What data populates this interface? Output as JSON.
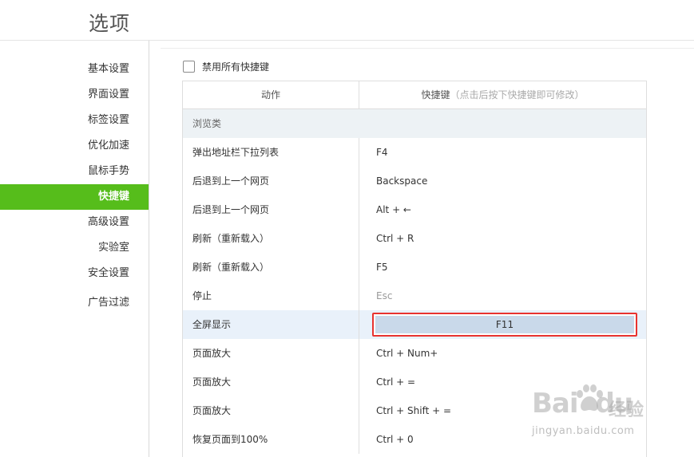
{
  "page": {
    "title": "选项"
  },
  "sidebar": {
    "items": [
      {
        "label": "基本设置",
        "active": false
      },
      {
        "label": "界面设置",
        "active": false
      },
      {
        "label": "标签设置",
        "active": false
      },
      {
        "label": "优化加速",
        "active": false
      },
      {
        "label": "鼠标手势",
        "active": false
      },
      {
        "label": "快捷键",
        "active": true
      },
      {
        "label": "高级设置",
        "active": false
      },
      {
        "label": "实验室",
        "active": false
      },
      {
        "label": "安全设置",
        "active": false
      },
      {
        "label": "广告过滤",
        "active": false
      }
    ]
  },
  "options": {
    "disable_all_label": "禁用所有快捷键",
    "disable_all_checked": false
  },
  "table": {
    "header": {
      "action": "动作",
      "shortcut": "快捷键",
      "shortcut_hint": "（点击后按下快捷键即可修改）"
    },
    "category": "浏览类",
    "rows": [
      {
        "action": "弹出地址栏下拉列表",
        "key": "F4"
      },
      {
        "action": "后退到上一个网页",
        "key": "Backspace"
      },
      {
        "action": "后退到上一个网页",
        "key": "Alt + ←"
      },
      {
        "action": "刷新（重新载入）",
        "key": "Ctrl + R"
      },
      {
        "action": "刷新（重新载入）",
        "key": "F5"
      },
      {
        "action": "停止",
        "key": "Esc"
      },
      {
        "action": "全屏显示",
        "key": "F11"
      },
      {
        "action": "页面放大",
        "key": "Ctrl + Num+"
      },
      {
        "action": "页面放大",
        "key": "Ctrl + ="
      },
      {
        "action": "页面放大",
        "key": "Ctrl + Shift + ="
      },
      {
        "action": "恢复页面到100%",
        "key": "Ctrl + 0"
      }
    ]
  },
  "watermark": {
    "brand": "Bai",
    "brand_suffix": "du",
    "product": "经验",
    "url": "jingyan.baidu.com"
  },
  "colors": {
    "accent_green": "#56bd1b",
    "highlight_row": "#e9f1fa",
    "editor_fill": "#c9d9ea",
    "annotation_red": "#e8332f",
    "category_bg": "#edf2f5"
  }
}
